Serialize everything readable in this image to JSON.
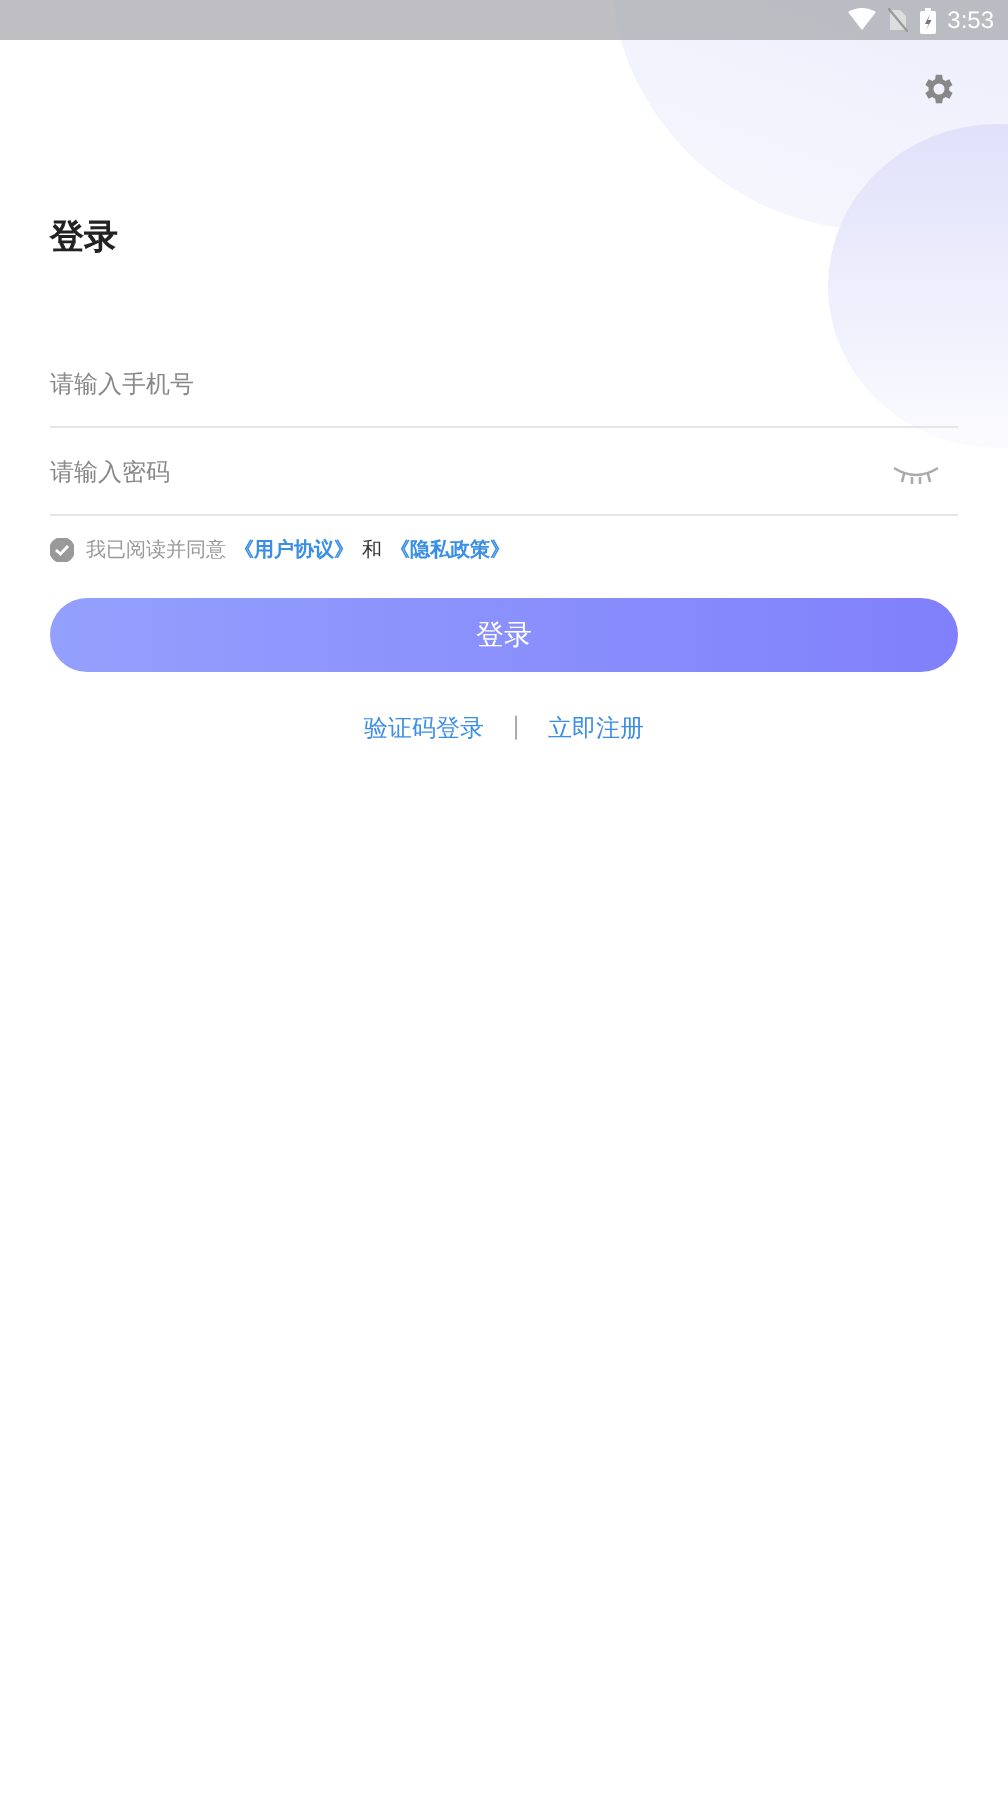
{
  "status_bar": {
    "time": "3:53"
  },
  "title": "登录",
  "phone_field": {
    "placeholder": "请输入手机号"
  },
  "password_field": {
    "placeholder": "请输入密码"
  },
  "agreement": {
    "checked": true,
    "text": "我已阅读并同意",
    "user_agreement": "《用户协议》",
    "conjunction": "和",
    "privacy_policy": "《隐私政策》"
  },
  "login_button": "登录",
  "links": [
    {
      "kind": "link",
      "text": "验证码登录"
    },
    {
      "kind": "separator",
      "text": "|"
    },
    {
      "kind": "link",
      "text": "立即注册"
    }
  ]
}
